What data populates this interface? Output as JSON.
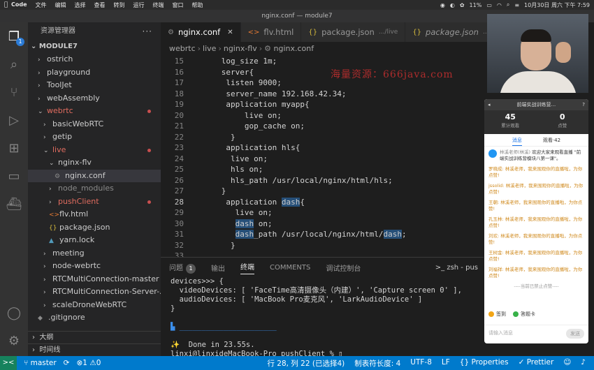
{
  "menubar": {
    "items": [
      "Code",
      "文件",
      "编辑",
      "选择",
      "查看",
      "转到",
      "运行",
      "终端",
      "窗口",
      "帮助"
    ],
    "battery": "11%",
    "datetime": "10月30日 周六 下午 7:59"
  },
  "window": {
    "title": "nginx.conf — module7"
  },
  "activity": {
    "explorer_badge": "1"
  },
  "sidebar": {
    "header": "资源管理器",
    "more": "···",
    "workspace": "MODULE7",
    "tree": [
      {
        "label": "ostrich",
        "indent": 1,
        "chev": "›",
        "style": "",
        "dot": false
      },
      {
        "label": "playground",
        "indent": 1,
        "chev": "›",
        "style": "",
        "dot": false
      },
      {
        "label": "ToolJet",
        "indent": 1,
        "chev": "›",
        "style": "",
        "dot": false
      },
      {
        "label": "webAssembly",
        "indent": 1,
        "chev": "›",
        "style": "",
        "dot": false
      },
      {
        "label": "webrtc",
        "indent": 1,
        "chev": "⌄",
        "style": "red",
        "dot": true
      },
      {
        "label": "basicWebRTC",
        "indent": 2,
        "chev": "›",
        "style": "",
        "dot": false
      },
      {
        "label": "getip",
        "indent": 2,
        "chev": "›",
        "style": "",
        "dot": false
      },
      {
        "label": "live",
        "indent": 2,
        "chev": "⌄",
        "style": "red",
        "dot": true
      },
      {
        "label": "nginx-flv",
        "indent": 3,
        "chev": "⌄",
        "style": "",
        "dot": false
      },
      {
        "label": "nginx.conf",
        "indent": 4,
        "chev": "",
        "icon": "⚙",
        "style": "selected",
        "dot": false
      },
      {
        "label": "node_modules",
        "indent": 3,
        "chev": "›",
        "style": "dim",
        "dot": false
      },
      {
        "label": "pushClient",
        "indent": 3,
        "chev": "›",
        "style": "red",
        "dot": true
      },
      {
        "label": "flv.html",
        "indent": 3,
        "chev": "",
        "icon": "<>",
        "style": "",
        "dot": false
      },
      {
        "label": "package.json",
        "indent": 3,
        "chev": "",
        "icon": "{}",
        "style": "",
        "dot": false
      },
      {
        "label": "yarn.lock",
        "indent": 3,
        "chev": "",
        "icon": "▲",
        "style": "",
        "dot": false
      },
      {
        "label": "meeting",
        "indent": 2,
        "chev": "›",
        "style": "",
        "dot": false
      },
      {
        "label": "node-webrtc",
        "indent": 2,
        "chev": "›",
        "style": "",
        "dot": false
      },
      {
        "label": "RTCMultiConnection-master",
        "indent": 2,
        "chev": "›",
        "style": "",
        "dot": false
      },
      {
        "label": "RTCMultiConnection-Server-...",
        "indent": 2,
        "chev": "›",
        "style": "",
        "dot": false
      },
      {
        "label": "scaleDroneWebRTC",
        "indent": 2,
        "chev": "›",
        "style": "",
        "dot": false
      },
      {
        "label": ".gitignore",
        "indent": 1,
        "chev": "",
        "icon": "◆",
        "style": "",
        "dot": false
      }
    ],
    "outline": "大纲",
    "timeline": "时间线"
  },
  "tabs": [
    {
      "label": "nginx.conf",
      "icon": "⚙",
      "active": true,
      "path": "",
      "italic": false
    },
    {
      "label": "flv.html",
      "icon": "<>",
      "active": false,
      "path": "",
      "italic": false
    },
    {
      "label": "package.json",
      "icon": "{}",
      "active": false,
      "path": ".../live",
      "italic": false
    },
    {
      "label": "package.json",
      "icon": "{}",
      "active": false,
      "path": ".../p",
      "italic": true
    }
  ],
  "breadcrumb": [
    "webrtc",
    "live",
    "nginx-flv",
    "nginx.conf"
  ],
  "editor": {
    "lines": [
      {
        "n": 15,
        "text": "      log_size 1m;"
      },
      {
        "n": 16,
        "text": "      server{"
      },
      {
        "n": 17,
        "text": "       listen 9000;"
      },
      {
        "n": 18,
        "text": "       server_name 192.168.42.34;"
      },
      {
        "n": 19,
        "text": "       application myapp{"
      },
      {
        "n": 20,
        "text": "           live on;"
      },
      {
        "n": 21,
        "text": "           gop_cache on;"
      },
      {
        "n": 22,
        "text": "        }"
      },
      {
        "n": 23,
        "text": "       application hls{"
      },
      {
        "n": 24,
        "text": "        live on;"
      },
      {
        "n": 25,
        "text": "        hls on;"
      },
      {
        "n": 26,
        "text": "        hls_path /usr/local/nginx/html/hls;"
      },
      {
        "n": 27,
        "text": "      }"
      },
      {
        "n": 28,
        "pre": "       application ",
        "hl": "dash",
        "post": "{",
        "current": true
      },
      {
        "n": 29,
        "text": "         live on;"
      },
      {
        "n": 30,
        "pre": "         ",
        "hl": "dash",
        "post": " on;"
      },
      {
        "n": 31,
        "pre": "         ",
        "hl": "dash",
        "post": "_path /usr/local/nginx/html/",
        "hl2": "dash",
        "post2": ";"
      },
      {
        "n": 32,
        "text": "        }"
      },
      {
        "n": 33,
        "text": ""
      }
    ],
    "watermark": "海量资源：666java.com"
  },
  "panel": {
    "tabs": [
      "问题",
      "输出",
      "终端",
      "COMMENTS",
      "调试控制台"
    ],
    "problems_count": "1",
    "active_tab": "终端",
    "terminal_name": "zsh - pus",
    "terminal_lines": [
      "devices>>> {",
      "  videoDevices: [ 'FaceTime高清摄像头（内建）', 'Capture screen 0' ],",
      "  audioDevices: [ 'MacBook Pro麦克风', 'LarkAudioDevice' ]",
      "}",
      "",
      "▙ ______________________",
      "",
      "✨  Done in 23.55s.",
      "linxi@linxideMacBook-Pro pushClient % ▯"
    ]
  },
  "statusbar": {
    "branch": "master",
    "errors": "⊗1 ⚠0",
    "cursor": "行 28, 列 22 (已选择4)",
    "tab_size": "制表符长度: 4",
    "encoding": "UTF-8",
    "eol": "LF",
    "properties": "Properties",
    "prettier": "✓ Prettier"
  },
  "live": {
    "title": "前端实战训练营...",
    "viewers": "45",
    "viewers_label": "累计观看",
    "likes": "0",
    "likes_label": "点赞",
    "tab_messages": "消息",
    "tab_watching": "观看·42",
    "system_name": "林溪老师(林溪)",
    "system_text": "欢迎大家来观看直播 \"前端实战训练营模块八第一课\"。",
    "messages": [
      {
        "who": "罗晓成:",
        "text": "林溪老师，我来围观你的直播啦，为你点赞!"
      },
      {
        "who": "jssolid:",
        "text": "林溪老师，我来围观你的直播啦，为你点赞!"
      },
      {
        "who": "王朝:",
        "text": "林溪老师，我来围观你的直播啦，为你点赞!"
      },
      {
        "who": "孔玉林:",
        "text": "林溪老师，我来围观你的直播啦，为你点赞!"
      },
      {
        "who": "刘欢:",
        "text": "林溪老师，我来围观你的直播啦，为你点赞!"
      },
      {
        "who": "王树金:",
        "text": "林溪老师，我来围观你的直播啦，为你点赞!"
      },
      {
        "who": "刘福祥:",
        "text": "林溪老师，我来围观你的直播啦，为你点赞!"
      }
    ],
    "notice": "----当前已禁止点赞----",
    "signin": "签到",
    "answer_card": "答题卡",
    "input_placeholder": "请输入消息",
    "send": "发送"
  }
}
